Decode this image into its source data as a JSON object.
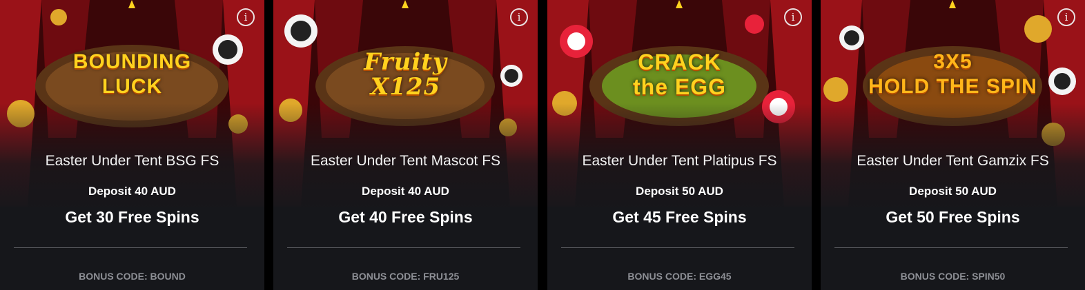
{
  "cards": [
    {
      "game_logo": "BOUNDING\nLUCK",
      "title": "Easter Under Tent BSG FS",
      "deposit": "Deposit 40 AUD",
      "offer": "Get 30 Free Spins",
      "bonus_code": "BONUS CODE: BOUND",
      "info_icon": "info-icon"
    },
    {
      "game_logo": "Fruity\nX125",
      "title": "Easter Under Tent Mascot FS",
      "deposit": "Deposit 40 AUD",
      "offer": "Get 40 Free Spins",
      "bonus_code": "BONUS CODE: FRU125",
      "info_icon": "info-icon"
    },
    {
      "game_logo": "CRACK\nthe EGG",
      "title": "Easter Under Tent Platipus FS",
      "deposit": "Deposit 50 AUD",
      "offer": "Get 45 Free Spins",
      "bonus_code": "BONUS CODE: EGG45",
      "info_icon": "info-icon"
    },
    {
      "game_logo": "3X5\nHOLD THE SPIN",
      "title": "Easter Under Tent Gamzix FS",
      "deposit": "Deposit 50 AUD",
      "offer": "Get 50 Free Spins",
      "bonus_code": "BONUS CODE: SPIN50",
      "info_icon": "info-icon"
    }
  ],
  "colors": {
    "card_bg": "#16171b",
    "curtain_red": "#8a0f14",
    "gold": "#ffd21f",
    "text": "#ffffff",
    "muted": "#8d8f95"
  }
}
